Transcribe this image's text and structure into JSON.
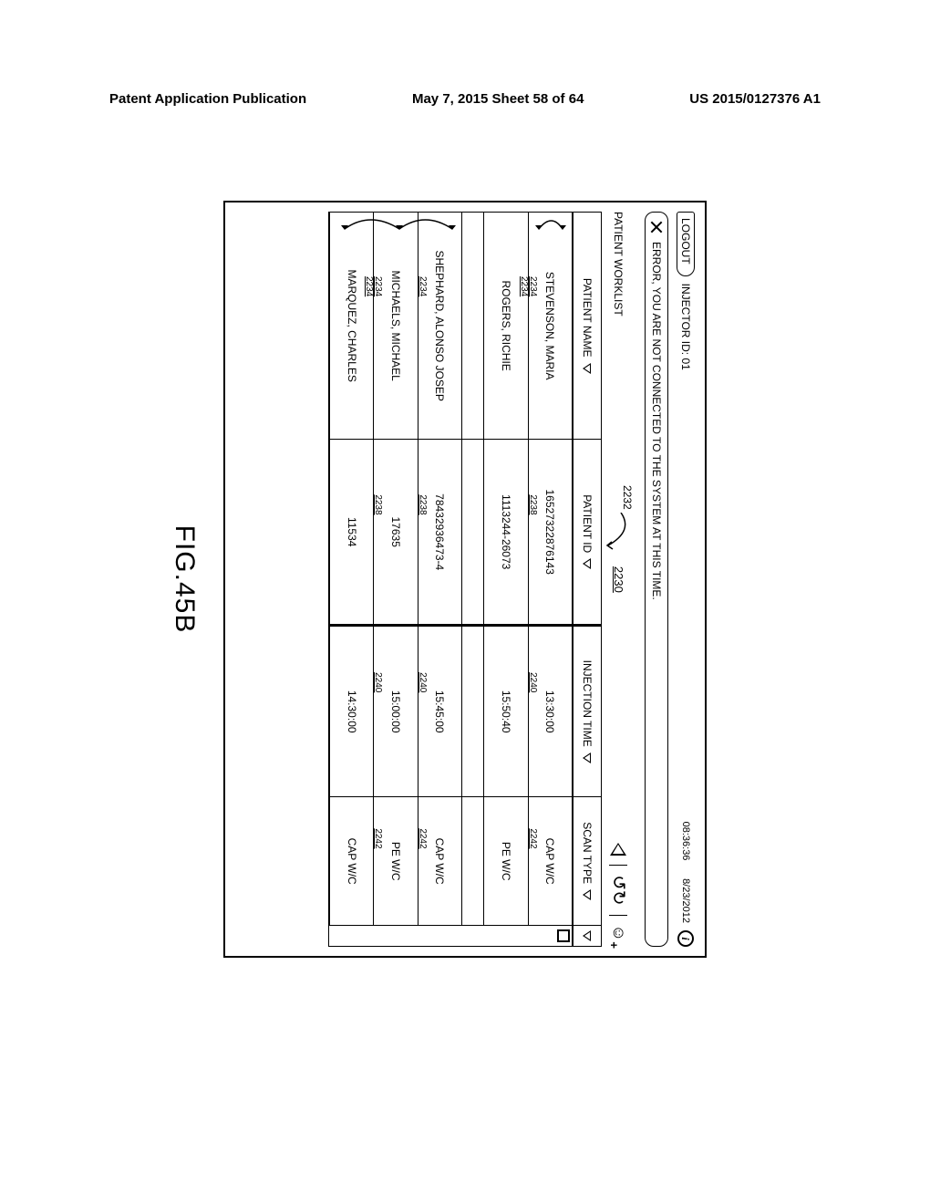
{
  "page_header": {
    "left": "Patent Application Publication",
    "center": "May 7, 2015   Sheet 58 of 64",
    "right": "US 2015/0127376 A1"
  },
  "topbar": {
    "logout": "LOGOUT",
    "injector_label": "INJECTOR ID:",
    "injector_id": "01",
    "time": "08:36:36",
    "date": "8/23/2012"
  },
  "error": "ERROR, YOU ARE NOT CONNECTED TO THE SYSTEM AT THIS TIME.",
  "worklist_label": "PATIENT WORKLIST",
  "ref_table": "2230",
  "ref_callout": "2232",
  "columns": {
    "name": "PATIENT NAME",
    "pid": "PATIENT ID",
    "time": "INJECTION TIME",
    "scan": "SCAN TYPE"
  },
  "rows": [
    {
      "name": "STEVENSON, MARIA",
      "pid": "16527322876143",
      "time": "13:30:00",
      "scan": "CAP W/C"
    },
    {
      "name": "ROGERS, RICHIE",
      "pid": "1113244-26073",
      "time": "15:50:40",
      "scan": "PE W/C"
    },
    {
      "gap": true
    },
    {
      "name": "SHEPHARD, ALONSO JOSEP",
      "pid": "78432936473-4",
      "time": "15:45:00",
      "scan": "CAP W/C"
    },
    {
      "name": "MICHAELS, MICHAEL",
      "pid": "17635",
      "time": "15:00:00",
      "scan": "PE W/C"
    },
    {
      "name": "MARQUEZ, CHARLES",
      "pid": "11534",
      "time": "14:30:00",
      "scan": "CAP W/C"
    }
  ],
  "ref_small": {
    "name": "2234",
    "pid": "2238",
    "time": "2240",
    "scan": "2242"
  },
  "figure_label": "FIG.45B"
}
